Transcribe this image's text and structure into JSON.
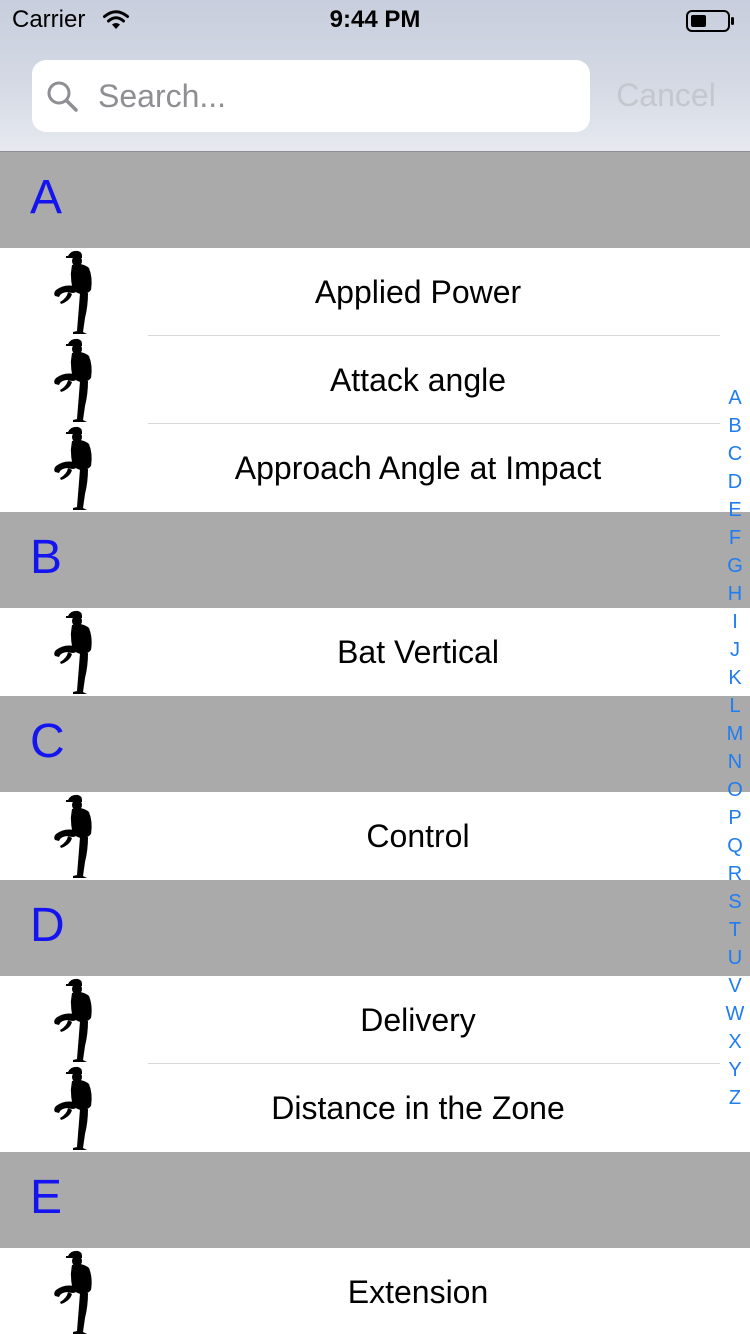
{
  "status_bar": {
    "carrier": "Carrier",
    "time": "9:44 PM",
    "wifi_icon": "wifi-icon",
    "battery_icon": "battery-icon"
  },
  "search": {
    "placeholder": "Search...",
    "value": "",
    "cancel_label": "Cancel",
    "icon": "search-icon"
  },
  "colors": {
    "section_header_bg": "#aaaaaa",
    "section_letter": "#1414f0",
    "index_letter": "#1f7cf1",
    "cancel_disabled": "#c4c7ce"
  },
  "sections": [
    {
      "letter": "A",
      "rows": [
        "Applied Power",
        "Attack angle",
        "Approach Angle at Impact"
      ]
    },
    {
      "letter": "B",
      "rows": [
        "Bat Vertical"
      ]
    },
    {
      "letter": "C",
      "rows": [
        "Control"
      ]
    },
    {
      "letter": "D",
      "rows": [
        "Delivery",
        "Distance in the Zone"
      ]
    },
    {
      "letter": "E",
      "rows": [
        "Extension"
      ]
    }
  ],
  "row_icon": "pitcher-silhouette-icon",
  "index": [
    "A",
    "B",
    "C",
    "D",
    "E",
    "F",
    "G",
    "H",
    "I",
    "J",
    "K",
    "L",
    "M",
    "N",
    "O",
    "P",
    "Q",
    "R",
    "S",
    "T",
    "U",
    "V",
    "W",
    "X",
    "Y",
    "Z"
  ]
}
